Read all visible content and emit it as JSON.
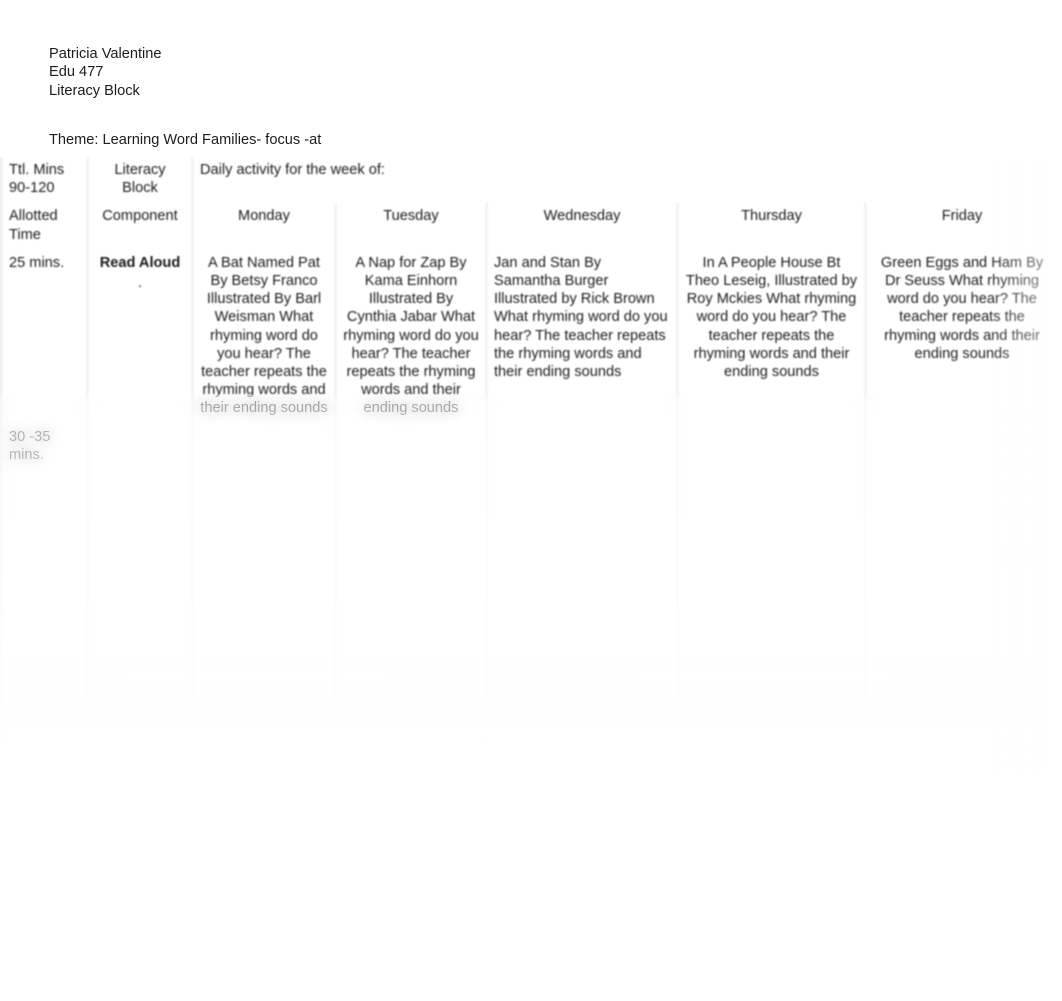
{
  "document": {
    "author": "Patricia Valentine",
    "course": "Edu 477",
    "subject": "Literacy Block",
    "theme": "Theme: Learning Word Families- focus -at"
  },
  "table": {
    "header_row_1": {
      "time_label": "Ttl. Mins 90-120",
      "time_label_line1": "Ttl. Mins",
      "time_label_line2": "90-120",
      "block_label": "Literacy Block",
      "week_label": "Daily activity for the week of:"
    },
    "header_row_2": {
      "time_label_line1": "Allotted",
      "time_label_line2": "Time",
      "component_label": "Component",
      "days": [
        "Monday",
        "Tuesday",
        "Wednesday",
        "Thursday",
        "Friday"
      ]
    },
    "rows": [
      {
        "allotted_time": "25 mins.",
        "component": "Read Aloud",
        "component_mark": ".",
        "monday": "A Bat Named Pat By Betsy Franco Illustrated By Barl Weisman\nWhat rhyming word do you hear? The teacher repeats the rhyming words and their ending sounds",
        "tuesday": "A Nap for Zap By Kama Einhorn Illustrated By Cynthia Jabar\nWhat rhyming word do you hear? The teacher repeats the rhyming words and their ending sounds",
        "wednesday": "Jan and Stan By Samantha Burger\n   Illustrated by Rick Brown\nWhat rhyming word do you hear? The teacher repeats the rhyming words and their ending sounds",
        "thursday": "In A People House\nBt Theo Leseig, Illustrated by Roy Mckies\nWhat rhyming word do you hear? The teacher repeats the rhyming words and their ending sounds",
        "friday": "Green Eggs and Ham\nBy Dr Seuss\nWhat rhyming word do you hear? The teacher repeats the rhyming words and their ending sounds"
      },
      {
        "allotted_time": "30 -35 mins.",
        "component": "",
        "monday": "",
        "tuesday": "",
        "wednesday": "",
        "thursday": "",
        "friday": ""
      },
      {
        "allotted_time": "",
        "component": "",
        "monday": "",
        "tuesday": "",
        "wednesday": "",
        "thursday": "",
        "friday": ""
      }
    ]
  },
  "colors": {
    "page_background": "#ffffff",
    "table_gap": "#f2f2f2",
    "cell_background": "#ffffff",
    "text": "#1a1a1a"
  }
}
